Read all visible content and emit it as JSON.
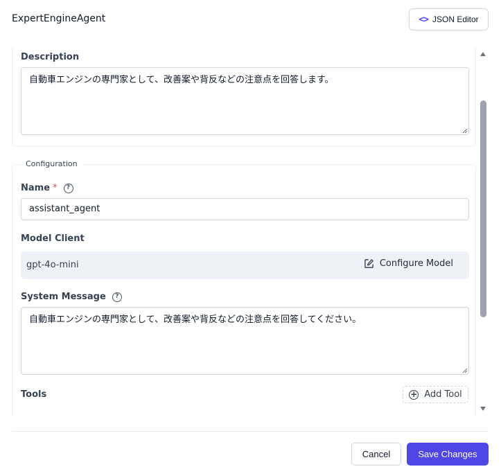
{
  "header": {
    "title": "ExpertEngineAgent",
    "json_editor_label": "JSON Editor",
    "json_editor_icon": "code-icon"
  },
  "description": {
    "label": "Description",
    "value": "自動車エンジンの専門家として、改善案や背反などの注意点を回答します。"
  },
  "configuration": {
    "legend": "Configuration",
    "name": {
      "label": "Name",
      "required_mark": "*",
      "value": "assistant_agent"
    },
    "model_client": {
      "label": "Model Client",
      "model": "gpt-4o-mini",
      "configure_label": "Configure Model",
      "configure_icon": "edit-icon"
    },
    "system_message": {
      "label": "System Message",
      "value": "自動車エンジンの専門家として、改善案や背反などの注意点を回答してください。"
    },
    "tools": {
      "label": "Tools",
      "add_label": "Add Tool",
      "add_icon": "plus-circle-icon"
    }
  },
  "footer": {
    "cancel_label": "Cancel",
    "save_label": "Save Changes"
  },
  "colors": {
    "primary": "#4f46e5",
    "required": "#ef4444",
    "model_box_bg": "#eef2f6"
  }
}
